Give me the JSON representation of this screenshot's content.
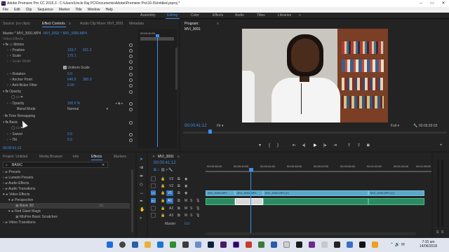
{
  "window": {
    "title": "Adobe Premiere Pro CC 2015.3 - C:\\Users\\Uncle Raj PC\\Documents\\Adobe\\Premiere Pro\\10.0\\Untitled.prproj *",
    "app_icon": "Pr"
  },
  "menu": [
    "File",
    "Edit",
    "Clip",
    "Sequence",
    "Marker",
    "Title",
    "Window",
    "Help"
  ],
  "workspaces": {
    "items": [
      "Assembly",
      "Editing",
      "Color",
      "Effects",
      "Audio",
      "Titles",
      "Libraries"
    ],
    "active": "Editing",
    "more": "»"
  },
  "effect_controls": {
    "tabs": [
      "Source: (no clips)",
      "Effect Controls",
      "Audio Clip Mixer: MVI_3091",
      "Metadata"
    ],
    "active_tab": "Effect Controls",
    "menu_glyph": "≡",
    "master_clip": "Master * MVI_3091.MP4",
    "sequence_clip": "MVI_3091 * MVI_3090.MP4",
    "mini_timecode": "00:00:40:00",
    "video_effects_header": "Video Effects",
    "motion": "Motion",
    "rows": [
      {
        "label": "Position",
        "value": "159.7",
        "value2": "631.2"
      },
      {
        "label": "Scale",
        "value": "175.1",
        "value2": ""
      },
      {
        "label": "Scale Width",
        "value": "",
        "value2": ""
      },
      {
        "label": "Uniform Scale",
        "value": "",
        "value2": ""
      },
      {
        "label": "Rotation",
        "value": "0.0",
        "value2": ""
      },
      {
        "label": "Anchor Point",
        "value": "640.0",
        "value2": "360.0"
      },
      {
        "label": "Anti-flicker Filter",
        "value": "0.00",
        "value2": ""
      }
    ],
    "opacity_header": "Opacity",
    "opacity": {
      "label": "Opacity",
      "value": "100.0 %"
    },
    "blend_mode": {
      "label": "Blend Mode",
      "value": "Normal"
    },
    "time_remapping": "Time Remapping",
    "basic_3d": "Basic",
    "swivel": {
      "label": "Swivel",
      "value": "0.0"
    },
    "tilt": {
      "label": "Tilt",
      "value": "0.0"
    },
    "timecode": "00:00:41:12"
  },
  "program_monitor": {
    "title": "Program: MVI_3091",
    "menu_glyph": "≡",
    "timecode": "00:00:41:12",
    "fit": "Fit",
    "quality": "Full",
    "duration": "00:06:29:03",
    "transport": [
      "marker-icon",
      "in-point-icon",
      "out-point-icon",
      "go-to-in-icon",
      "step-back-icon",
      "play-icon",
      "step-forward-icon",
      "go-to-out-icon",
      "lift-icon",
      "extract-icon",
      "export-frame-icon",
      "plus-icon"
    ]
  },
  "project_panel": {
    "tabs": [
      "Project: Untitled",
      "Media Browser",
      "Info",
      "Effects",
      "Markers"
    ],
    "active_tab": "Effects",
    "search_value": "BASIC",
    "tree": [
      {
        "label": "Presets",
        "level": 0,
        "expanded": false
      },
      {
        "label": "Lumetri Presets",
        "level": 0,
        "expanded": false
      },
      {
        "label": "Audio Effects",
        "level": 0,
        "expanded": false
      },
      {
        "label": "Audio Transitions",
        "level": 0,
        "expanded": false
      },
      {
        "label": "Video Effects",
        "level": 0,
        "expanded": true
      },
      {
        "label": "Perspective",
        "level": 1,
        "expanded": true
      },
      {
        "label": "Basic 3D",
        "level": 2,
        "expanded": false,
        "selected": true
      },
      {
        "label": "Red Giant Magic",
        "level": 1,
        "expanded": true
      },
      {
        "label": "MisFire Basic Scratches",
        "level": 2,
        "expanded": false
      },
      {
        "label": "Video Transitions",
        "level": 0,
        "expanded": false
      }
    ]
  },
  "timeline": {
    "tab": "MVI_3091",
    "menu_glyph": "≡",
    "timecode": "00:00:41:12",
    "ruler": [
      "00:00:36:00",
      "00:00:40:00",
      "00:00:44:00",
      "00:00:48:00",
      "00:00:52:00",
      "00:00:56:00",
      "00:01:00:00",
      "00:01:04:00",
      "00:01:08:00"
    ],
    "tracks": [
      {
        "id": "V3",
        "type": "video"
      },
      {
        "id": "V2",
        "type": "video"
      },
      {
        "id": "V1",
        "type": "video"
      },
      {
        "id": "A1",
        "type": "audio"
      },
      {
        "id": "A2",
        "type": "audio"
      },
      {
        "id": "A3",
        "type": "audio"
      }
    ],
    "master": {
      "label": "Master",
      "value": "0.0"
    },
    "track_buttons": {
      "mute": "M",
      "solo": "S"
    },
    "clips_v1": [
      "MVI_3090.MP4",
      "MVI_3090.MP4",
      "MVI_3090.MP4 [V]",
      "MVI_3090.MP4 [V]"
    ],
    "meter_labels": [
      "S",
      "S"
    ]
  },
  "taskbar": {
    "time": "7:15 am",
    "date": "14/06/2018"
  },
  "colors": {
    "accent": "#3d8fe8",
    "video_clip": "#5aa8c9",
    "audio_clip": "#2c8a62",
    "panel_bg": "#232323"
  }
}
